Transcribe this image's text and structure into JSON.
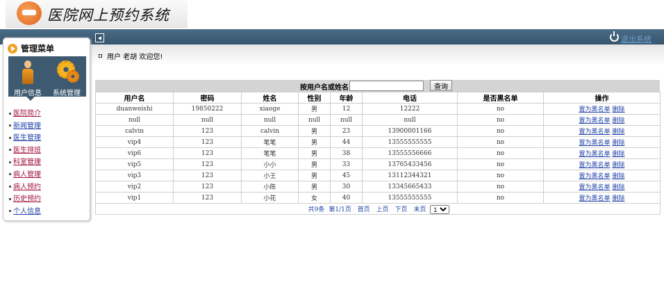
{
  "header": {
    "title": "医院网上预约系统",
    "logout": "退出系统"
  },
  "sidebar": {
    "title": "管理菜单",
    "buttons": [
      {
        "label": "用户信息",
        "icon": "user-icon"
      },
      {
        "label": "系统管理",
        "icon": "gear-icon"
      }
    ],
    "items": [
      {
        "label": "医院简介"
      },
      {
        "label": "新闻管理"
      },
      {
        "label": "医生管理"
      },
      {
        "label": "医生排班"
      },
      {
        "label": "科室管理"
      },
      {
        "label": "病人管理"
      },
      {
        "label": "病人预约"
      },
      {
        "label": "历史预约"
      },
      {
        "label": "个人信息"
      }
    ]
  },
  "welcome": "用户 老胡 欢迎您!",
  "search": {
    "label": "按用户名或姓名:",
    "value": "",
    "button": "查询"
  },
  "table": {
    "headers": [
      "用户名",
      "密码",
      "姓名",
      "性别",
      "年龄",
      "电话",
      "是否黑名单",
      "操作"
    ],
    "rows": [
      [
        "duanweishi",
        "19850222",
        "xiaoge",
        "男",
        "12",
        "12222",
        "no"
      ],
      [
        "null",
        "null",
        "null",
        "null",
        "null",
        "null",
        "no"
      ],
      [
        "calvin",
        "123",
        "calvin",
        "男",
        "23",
        "13900001166",
        "no"
      ],
      [
        "vip4",
        "123",
        "笔笔",
        "男",
        "44",
        "13555555555",
        "no"
      ],
      [
        "vip6",
        "123",
        "笔笔",
        "男",
        "38",
        "13555556666",
        "no"
      ],
      [
        "vip5",
        "123",
        "小小",
        "男",
        "33",
        "13765433456",
        "no"
      ],
      [
        "vip3",
        "123",
        "小王",
        "男",
        "45",
        "13112344321",
        "no"
      ],
      [
        "vip2",
        "123",
        "小陈",
        "男",
        "30",
        "13345665433",
        "no"
      ],
      [
        "vip1",
        "123",
        "小花",
        "女",
        "40",
        "13555555555",
        "no"
      ]
    ],
    "action_blacklist": "置为黑名单",
    "action_delete": "删除"
  },
  "pager": {
    "total": "共9条",
    "page": "第1/1页",
    "first": "首页",
    "prev": "上页",
    "next": "下页",
    "last": "末页",
    "selected": "1"
  }
}
